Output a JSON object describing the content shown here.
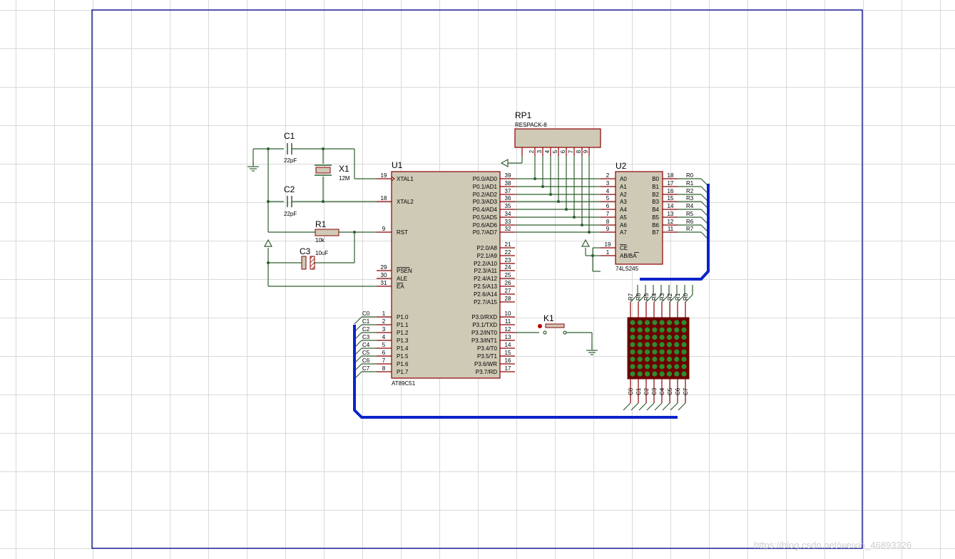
{
  "watermark": "https://blog.csdn.net/weixin_46893326",
  "colors": {
    "wire": "#2f5e2f",
    "pin": "#8b0000",
    "body": "#cfcab6",
    "border": "#00008b",
    "bus": "#0a24c9",
    "led": "#2e8b2e",
    "ledbg": "#6b0000"
  },
  "u1": {
    "ref": "U1",
    "part": "AT89C51",
    "left_pins": [
      {
        "n": "19",
        "name": "XTAL1"
      },
      {
        "n": "18",
        "name": "XTAL2"
      },
      {
        "n": "9",
        "name": "RST"
      },
      {
        "n": "29",
        "name": "PSEN"
      },
      {
        "n": "30",
        "name": "ALE"
      },
      {
        "n": "31",
        "name": "EA"
      },
      {
        "n": "1",
        "name": "P1.0"
      },
      {
        "n": "2",
        "name": "P1.1"
      },
      {
        "n": "3",
        "name": "P1.2"
      },
      {
        "n": "4",
        "name": "P1.3"
      },
      {
        "n": "5",
        "name": "P1.4"
      },
      {
        "n": "6",
        "name": "P1.5"
      },
      {
        "n": "7",
        "name": "P1.6"
      },
      {
        "n": "8",
        "name": "P1.7"
      }
    ],
    "right_pins": [
      {
        "n": "39",
        "name": "P0.0/AD0"
      },
      {
        "n": "38",
        "name": "P0.1/AD1"
      },
      {
        "n": "37",
        "name": "P0.2/AD2"
      },
      {
        "n": "36",
        "name": "P0.3/AD3"
      },
      {
        "n": "35",
        "name": "P0.4/AD4"
      },
      {
        "n": "34",
        "name": "P0.5/AD5"
      },
      {
        "n": "33",
        "name": "P0.6/AD6"
      },
      {
        "n": "32",
        "name": "P0.7/AD7"
      },
      {
        "n": "21",
        "name": "P2.0/A8"
      },
      {
        "n": "22",
        "name": "P2.1/A9"
      },
      {
        "n": "23",
        "name": "P2.2/A10"
      },
      {
        "n": "24",
        "name": "P2.3/A11"
      },
      {
        "n": "25",
        "name": "P2.4/A12"
      },
      {
        "n": "26",
        "name": "P2.5/A13"
      },
      {
        "n": "27",
        "name": "P2.6/A14"
      },
      {
        "n": "28",
        "name": "P2.7/A15"
      },
      {
        "n": "10",
        "name": "P3.0/RXD"
      },
      {
        "n": "11",
        "name": "P3.1/TXD"
      },
      {
        "n": "12",
        "name": "P3.2/INT0"
      },
      {
        "n": "13",
        "name": "P3.3/INT1"
      },
      {
        "n": "14",
        "name": "P3.4/T0"
      },
      {
        "n": "15",
        "name": "P3.5/T1"
      },
      {
        "n": "16",
        "name": "P3.6/WR"
      },
      {
        "n": "17",
        "name": "P3.7/RD"
      }
    ],
    "p1_nets": [
      "C0",
      "C1",
      "C2",
      "C3",
      "C4",
      "C5",
      "C6",
      "C7"
    ]
  },
  "u2": {
    "ref": "U2",
    "part": "74LS245",
    "a_pins": [
      {
        "n": "2",
        "name": "A0"
      },
      {
        "n": "3",
        "name": "A1"
      },
      {
        "n": "4",
        "name": "A2"
      },
      {
        "n": "5",
        "name": "A3"
      },
      {
        "n": "6",
        "name": "A4"
      },
      {
        "n": "7",
        "name": "A5"
      },
      {
        "n": "8",
        "name": "A6"
      },
      {
        "n": "9",
        "name": "A7"
      }
    ],
    "b_pins": [
      {
        "n": "18",
        "name": "B0"
      },
      {
        "n": "17",
        "name": "B1"
      },
      {
        "n": "16",
        "name": "B2"
      },
      {
        "n": "15",
        "name": "B3"
      },
      {
        "n": "14",
        "name": "B4"
      },
      {
        "n": "13",
        "name": "B5"
      },
      {
        "n": "12",
        "name": "B6"
      },
      {
        "n": "11",
        "name": "B7"
      }
    ],
    "ce_pin": {
      "n": "19",
      "name": "CE"
    },
    "dir_pin": {
      "n": "1",
      "name": "AB/BA"
    },
    "b_nets": [
      "R0",
      "R1",
      "R2",
      "R3",
      "R4",
      "R5",
      "R6",
      "R7"
    ]
  },
  "rp1": {
    "ref": "RP1",
    "part": "RESPACK-8",
    "pins": [
      "1",
      "2",
      "3",
      "4",
      "5",
      "6",
      "7",
      "8",
      "9"
    ]
  },
  "c1": {
    "ref": "C1",
    "value": "22pF"
  },
  "c2": {
    "ref": "C2",
    "value": "22pF"
  },
  "c3": {
    "ref": "C3",
    "value": "10uF"
  },
  "x1": {
    "ref": "X1",
    "value": "12M"
  },
  "r1": {
    "ref": "R1",
    "value": "10k"
  },
  "k1": {
    "ref": "K1"
  },
  "matrix": {
    "rows": [
      "R7",
      "R6",
      "R5",
      "R4",
      "R3",
      "R2",
      "R1",
      "R0"
    ],
    "cols": [
      "C0",
      "C1",
      "C2",
      "C3",
      "C4",
      "C5",
      "C6",
      "C7"
    ]
  }
}
